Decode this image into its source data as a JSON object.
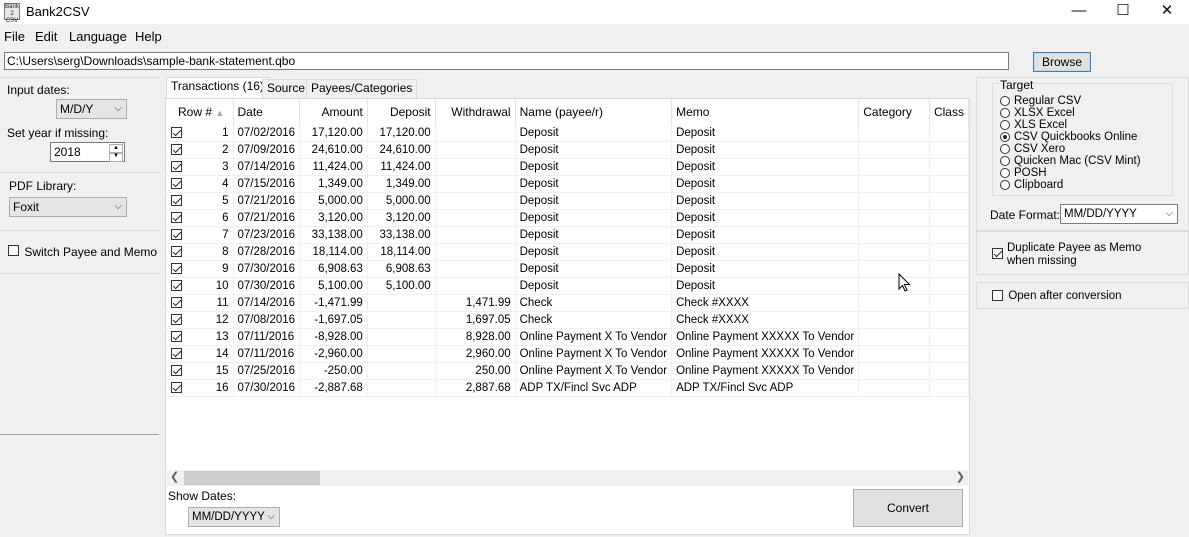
{
  "window": {
    "title": "Bank2CSV",
    "icon_text": "Bank 2 CSV",
    "icon": "bank2csv-icon",
    "controls": {
      "minimize": "—",
      "maximize": "☐",
      "close": "✕"
    }
  },
  "menu": [
    "File",
    "Edit",
    "Language",
    "Help"
  ],
  "file": {
    "path": "C:\\Users\\serg\\Downloads\\sample-bank-statement.qbo",
    "browse_label": "Browse"
  },
  "left_panel": {
    "input_dates_label": "Input dates:",
    "input_dates_value": "M/D/Y",
    "set_year_label": "Set year if missing:",
    "set_year_value": "2018",
    "pdf_library_label": "PDF Library:",
    "pdf_library_value": "Foxit",
    "switch_payee_memo_label": "Switch Payee and Memo",
    "switch_payee_memo_checked": false
  },
  "tabs": [
    "Transactions (16)",
    "Source",
    "Payees/Categories"
  ],
  "active_tab": 0,
  "table": {
    "columns": [
      "Row #",
      "Date",
      "Amount",
      "Deposit",
      "Withdrawal",
      "Name (payee/r)",
      "Memo",
      "Category",
      "Class"
    ],
    "rows": [
      {
        "row": "1",
        "date": "07/02/2016",
        "amount": "17,120.00",
        "deposit": "17,120.00",
        "withdrawal": "",
        "name": "Deposit",
        "memo": "Deposit"
      },
      {
        "row": "2",
        "date": "07/09/2016",
        "amount": "24,610.00",
        "deposit": "24,610.00",
        "withdrawal": "",
        "name": "Deposit",
        "memo": "Deposit"
      },
      {
        "row": "3",
        "date": "07/14/2016",
        "amount": "11,424.00",
        "deposit": "11,424.00",
        "withdrawal": "",
        "name": "Deposit",
        "memo": "Deposit"
      },
      {
        "row": "4",
        "date": "07/15/2016",
        "amount": "1,349.00",
        "deposit": "1,349.00",
        "withdrawal": "",
        "name": "Deposit",
        "memo": "Deposit"
      },
      {
        "row": "5",
        "date": "07/21/2016",
        "amount": "5,000.00",
        "deposit": "5,000.00",
        "withdrawal": "",
        "name": "Deposit",
        "memo": "Deposit"
      },
      {
        "row": "6",
        "date": "07/21/2016",
        "amount": "3,120.00",
        "deposit": "3,120.00",
        "withdrawal": "",
        "name": "Deposit",
        "memo": "Deposit"
      },
      {
        "row": "7",
        "date": "07/23/2016",
        "amount": "33,138.00",
        "deposit": "33,138.00",
        "withdrawal": "",
        "name": "Deposit",
        "memo": "Deposit"
      },
      {
        "row": "8",
        "date": "07/28/2016",
        "amount": "18,114.00",
        "deposit": "18,114.00",
        "withdrawal": "",
        "name": "Deposit",
        "memo": "Deposit"
      },
      {
        "row": "9",
        "date": "07/30/2016",
        "amount": "6,908.63",
        "deposit": "6,908.63",
        "withdrawal": "",
        "name": "Deposit",
        "memo": "Deposit"
      },
      {
        "row": "10",
        "date": "07/30/2016",
        "amount": "5,100.00",
        "deposit": "5,100.00",
        "withdrawal": "",
        "name": "Deposit",
        "memo": "Deposit"
      },
      {
        "row": "11",
        "date": "07/14/2016",
        "amount": "-1,471.99",
        "deposit": "",
        "withdrawal": "1,471.99",
        "name": "Check",
        "memo": "Check #XXXX"
      },
      {
        "row": "12",
        "date": "07/08/2016",
        "amount": "-1,697.05",
        "deposit": "",
        "withdrawal": "1,697.05",
        "name": "Check",
        "memo": "Check #XXXX"
      },
      {
        "row": "13",
        "date": "07/11/2016",
        "amount": "-8,928.00",
        "deposit": "",
        "withdrawal": "8,928.00",
        "name": "Online Payment X To Vendor",
        "memo": "Online Payment XXXXX To Vendor"
      },
      {
        "row": "14",
        "date": "07/11/2016",
        "amount": "-2,960.00",
        "deposit": "",
        "withdrawal": "2,960.00",
        "name": "Online Payment X To Vendor",
        "memo": "Online Payment XXXXX To Vendor"
      },
      {
        "row": "15",
        "date": "07/25/2016",
        "amount": "-250.00",
        "deposit": "",
        "withdrawal": "250.00",
        "name": "Online Payment X To Vendor",
        "memo": "Online Payment XXXXX To Vendor"
      },
      {
        "row": "16",
        "date": "07/30/2016",
        "amount": "-2,887.68",
        "deposit": "",
        "withdrawal": "2,887.68",
        "name": "ADP TX/Fincl Svc ADP",
        "memo": "ADP TX/Fincl Svc ADP"
      }
    ]
  },
  "bottom": {
    "show_dates_label": "Show Dates:",
    "show_dates_value": "MM/DD/YYYY",
    "convert_label": "Convert"
  },
  "right_panel": {
    "target_label": "Target",
    "targets": [
      "Regular CSV",
      "XLSX Excel",
      "XLS Excel",
      "CSV Quickbooks Online",
      "CSV Xero",
      "Quicken Mac (CSV Mint)",
      "POSH",
      "Clipboard"
    ],
    "selected_target": 3,
    "date_format_label": "Date Format:",
    "date_format_value": "MM/DD/YYYY",
    "duplicate_payee_label": "Duplicate Payee as Memo when missing",
    "duplicate_payee_checked": true,
    "open_after_label": "Open after conversion",
    "open_after_checked": false
  }
}
